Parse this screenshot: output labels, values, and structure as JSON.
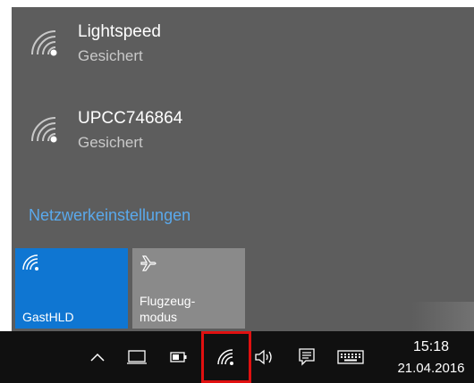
{
  "networks": [
    {
      "name": "Lightspeed",
      "status": "Gesichert",
      "icon": "wifi-secured-icon"
    },
    {
      "name": "UPCC746864",
      "status": "Gesichert",
      "icon": "wifi-secured-icon"
    }
  ],
  "settings_link": "Netzwerkeinstellungen",
  "tiles": {
    "wifi": {
      "label": "GastHLD",
      "icon": "wifi-icon",
      "color": "#0f76d2"
    },
    "airplane": {
      "label_line1": "Flugzeug-",
      "label_line2": "modus",
      "icon": "airplane-icon",
      "color": "#8a8a8a"
    }
  },
  "taskbar": {
    "icons": [
      "chevron-up-icon",
      "tablet-icon",
      "battery-icon",
      "wifi-icon",
      "volume-icon",
      "action-center-icon",
      "keyboard-icon"
    ],
    "time": "15:18",
    "date": "21.04.2016",
    "highlight_color": "#e01010"
  },
  "colors": {
    "flyout_bg": "#5d5d5d",
    "accent": "#0f76d2",
    "link": "#5aa9ec",
    "taskbar_bg": "#101010"
  }
}
